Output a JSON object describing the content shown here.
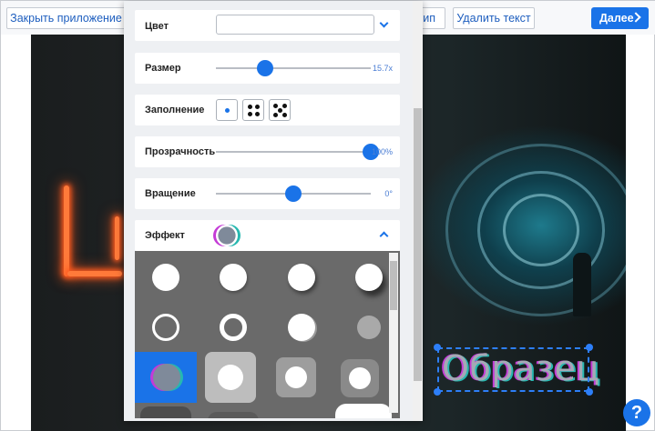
{
  "toolbar": {
    "close_app": "Закрыть приложение",
    "delete_text": "Удалить текст",
    "partial_tip": "тип",
    "next": "Далее"
  },
  "canvas": {
    "sample_text": "Образец"
  },
  "panel": {
    "color": {
      "label": "Цвет",
      "value": ""
    },
    "size": {
      "label": "Размер",
      "value": "15.7x",
      "fraction": 0.32
    },
    "fill": {
      "label": "Заполнение",
      "options": [
        "single-dot-icon",
        "four-dots-icon",
        "five-dots-icon"
      ],
      "selected": 0
    },
    "opacity": {
      "label": "Прозрачность",
      "value": "100%",
      "fraction": 1.0
    },
    "rotation": {
      "label": "Вращение",
      "value": "0°",
      "fraction": 0.5
    },
    "effect": {
      "label": "Эффект",
      "selected_index": 8
    }
  },
  "colors": {
    "accent": "#1a73e8",
    "effect_selected_bg": "#1a73e8",
    "effects_bg": "#6a6a6a"
  },
  "help": {
    "label": "?"
  }
}
